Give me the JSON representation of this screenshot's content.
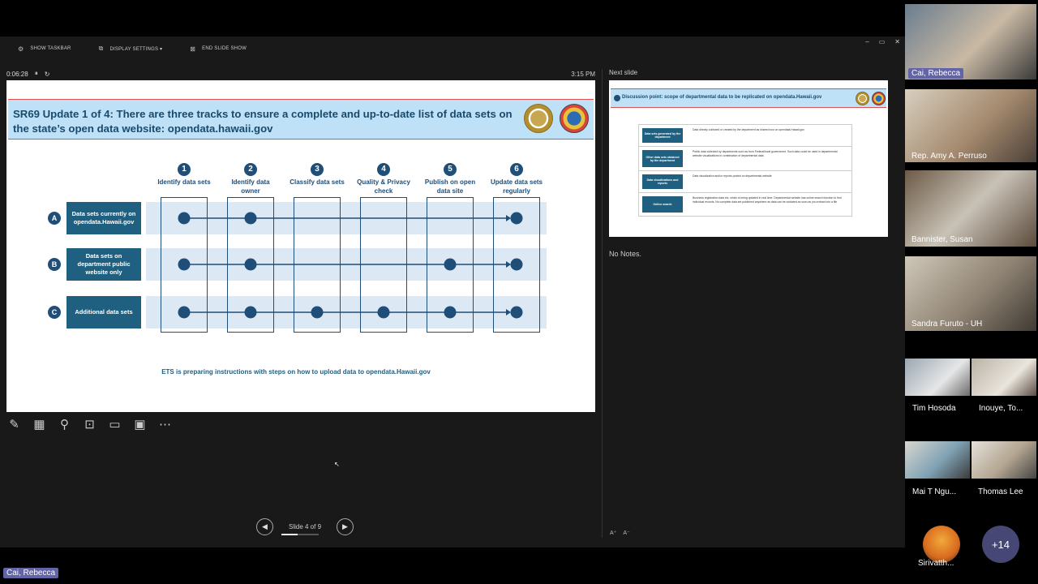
{
  "toolbar": {
    "show_taskbar": "SHOW TASKBAR",
    "display_settings": "DISPLAY SETTINGS ▾",
    "end_slide_show": "END SLIDE SHOW"
  },
  "window_controls": [
    "–",
    "▭",
    "✕"
  ],
  "timer": {
    "elapsed": "0:06:28",
    "pause": "⏸",
    "reset": "↻",
    "clock": "3:15 PM"
  },
  "slide": {
    "title": "SR69 Update 1 of 4: There are three tracks to ensure a complete and up-to-date list of data sets on the state’s open data website: opendata.hawaii.gov",
    "steps": [
      {
        "num": "1",
        "label": "Identify data sets"
      },
      {
        "num": "2",
        "label": "Identify data owner"
      },
      {
        "num": "3",
        "label": "Classify data sets"
      },
      {
        "num": "4",
        "label": "Quality & Privacy check"
      },
      {
        "num": "5",
        "label": "Publish on open data site"
      },
      {
        "num": "6",
        "label": "Update data sets regularly"
      }
    ],
    "tracks": [
      {
        "letter": "A",
        "label": "Data sets currently on opendata.Hawaii.gov",
        "steps_active": [
          1,
          2,
          6
        ]
      },
      {
        "letter": "B",
        "label": "Data sets on department public website only",
        "steps_active": [
          1,
          2,
          5,
          6
        ]
      },
      {
        "letter": "C",
        "label": "Additional data sets",
        "steps_active": [
          1,
          2,
          3,
          4,
          5,
          6
        ]
      }
    ],
    "footer": "ETS is preparing instructions with steps on how to upload data to opendata.Hawaii.gov",
    "colors": {
      "accent": "#1f4e79",
      "band": "#dce9f5",
      "title_bg": "#bfe1f7"
    }
  },
  "slide_tools": [
    "pen-icon",
    "grid-icon",
    "zoom-icon",
    "pointer-icon",
    "subtitles-icon",
    "camera-icon",
    "more-icon"
  ],
  "tool_glyphs": [
    "✎",
    "▦",
    "⚲",
    "⊡",
    "▭",
    "▣",
    "⋯"
  ],
  "navigation": {
    "prev": "◀",
    "next": "▶",
    "slide_counter": "Slide 4 of 9",
    "progress": 0.44
  },
  "next_slide": {
    "label": "Next slide",
    "title": "Discussion point: scope of departmental data to be replicated on opendata.Hawaii.gov",
    "rows": [
      {
        "label": "Data sets generated by the department",
        "text": "Data directly collected or created by the department as shared now on opendata.Hawaii.gov"
      },
      {
        "label": "Other data sets obtained by the department",
        "text": "Public data collected by departments such as from Federal/local government. Such data could be used in departmental website visualizations in combination of departmental data"
      },
      {
        "label": "Data visualizations and reports",
        "text": "Data visualization and/or reports posted on departmental website"
      },
      {
        "label": "Online search",
        "text": "Business registration data etc. which is being updated in real time. Departmental website has online search function to find individual records. No complete data set published anywhere as data can be outdated as soon as you extract into a file"
      }
    ]
  },
  "notes": "No Notes.",
  "font_controls": [
    "A⁺",
    "A⁻"
  ],
  "participants": [
    {
      "name": "Cai, Rebecca",
      "active": true
    },
    {
      "name": "Rep. Amy A. Perruso",
      "active": false
    },
    {
      "name": "Bannister, Susan",
      "active": false
    },
    {
      "name": "Sandra Furuto - UH",
      "active": false
    },
    {
      "name": "Tim Hosoda",
      "active": false
    },
    {
      "name": "Inouye, To...",
      "active": false
    },
    {
      "name": "Mai T Ngu...",
      "active": false
    },
    {
      "name": "Thomas Lee",
      "active": false
    },
    {
      "name": "Sirivatth...",
      "active": false
    }
  ],
  "more_participants": "+14",
  "presenter_tag": "Cai, Rebecca"
}
